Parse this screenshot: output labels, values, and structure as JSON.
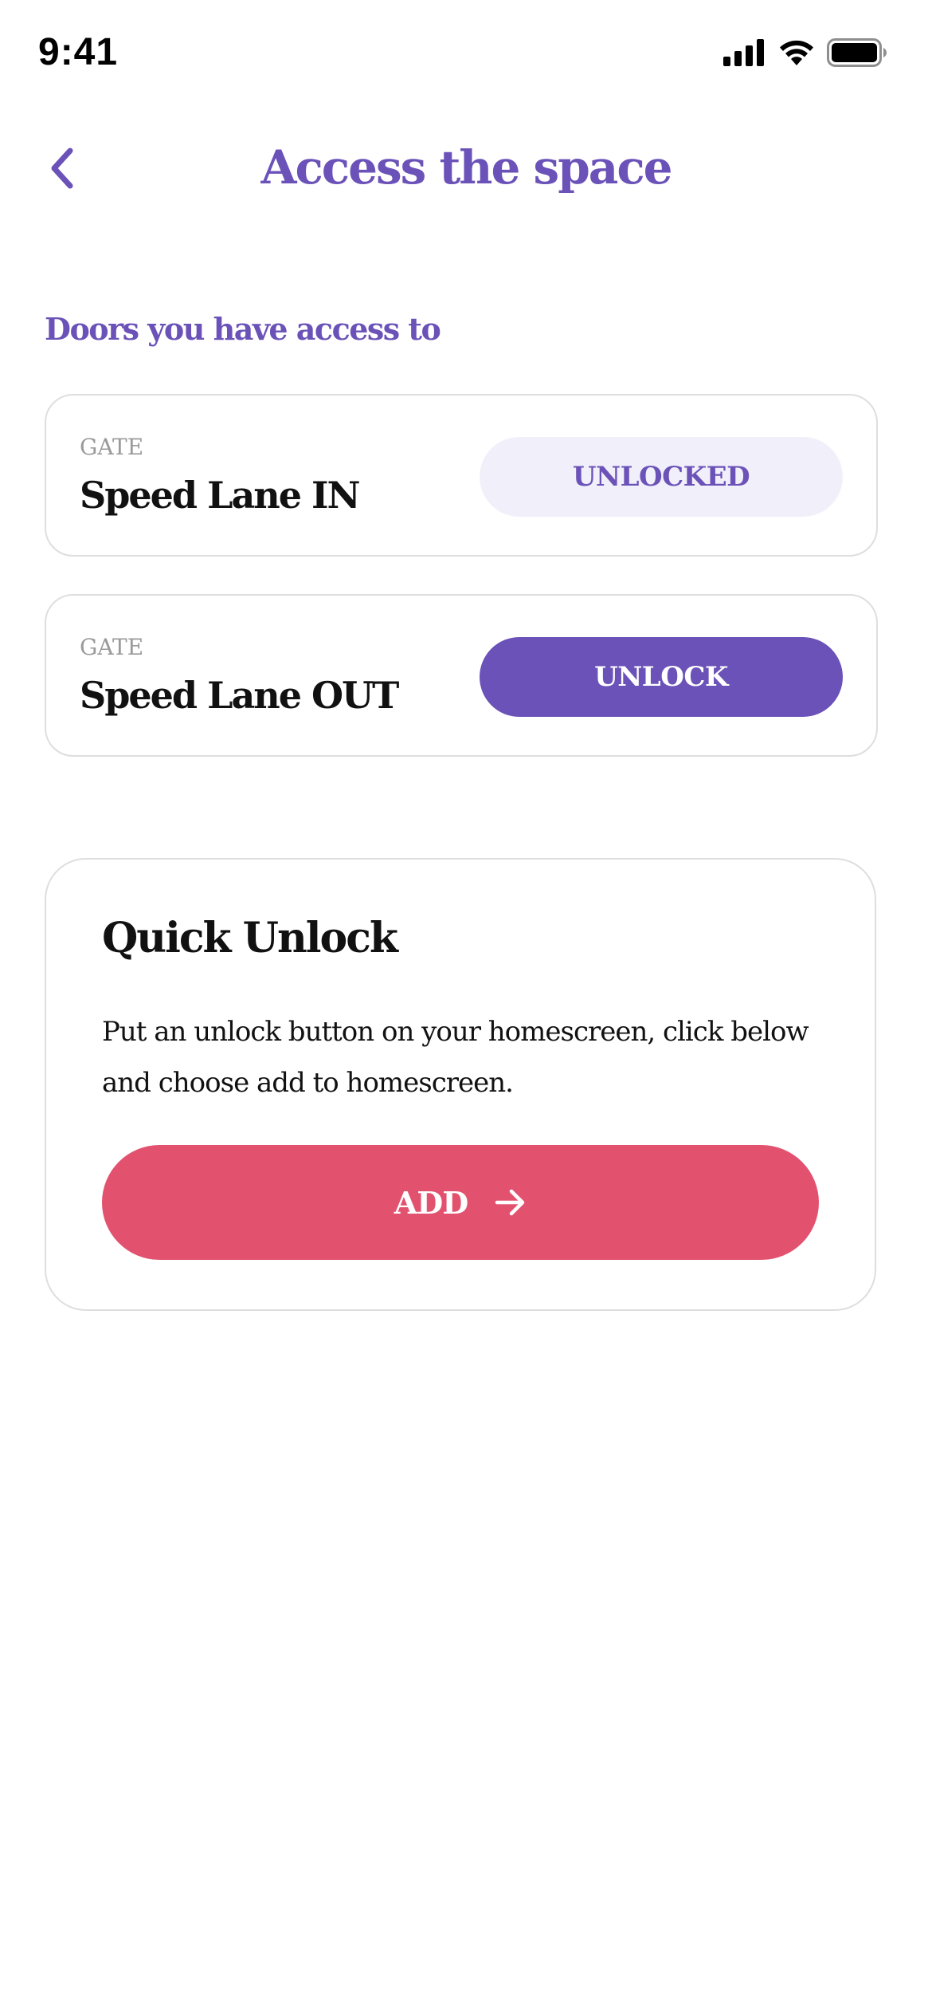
{
  "status_bar": {
    "time": "9:41"
  },
  "header": {
    "title": "Access the space",
    "back_icon": "chevron-left-icon"
  },
  "doors_section": {
    "heading": "Doors you have access to",
    "doors": [
      {
        "type": "GATE",
        "name": "Speed Lane IN",
        "action_label": "UNLOCKED",
        "state": "unlocked"
      },
      {
        "type": "GATE",
        "name": "Speed Lane OUT",
        "action_label": "UNLOCK",
        "state": "locked"
      }
    ]
  },
  "quick_unlock": {
    "title": "Quick Unlock",
    "description": "Put an unlock button on your homescreen, click below and choose add to homescreen.",
    "button_label": "ADD",
    "button_icon": "arrow-right-icon"
  },
  "colors": {
    "brand_purple": "#6b52b8",
    "unlocked_bg": "#f1effa",
    "add_button": "#e2526f",
    "border": "#dedede"
  }
}
